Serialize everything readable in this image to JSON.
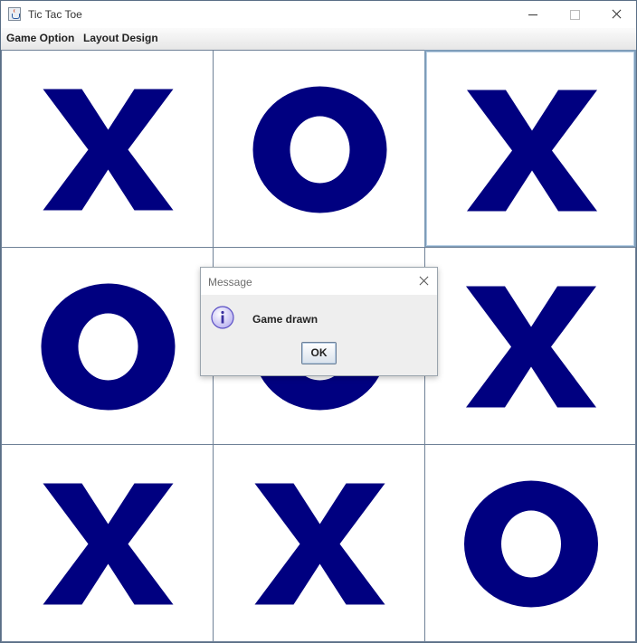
{
  "window": {
    "title": "Tic Tac Toe",
    "icon": "java-cup-icon"
  },
  "menu": {
    "items": [
      "Game Option",
      "Layout Design"
    ]
  },
  "board": {
    "mark_color": "#000080",
    "cells": [
      {
        "mark": "X"
      },
      {
        "mark": "O"
      },
      {
        "mark": "X"
      },
      {
        "mark": "O"
      },
      {
        "mark": "O"
      },
      {
        "mark": "X"
      },
      {
        "mark": "X"
      },
      {
        "mark": "X"
      },
      {
        "mark": "O"
      }
    ],
    "focused_cell": 2
  },
  "dialog": {
    "title": "Message",
    "icon": "info-icon",
    "message": "Game drawn",
    "ok_label": "OK"
  }
}
